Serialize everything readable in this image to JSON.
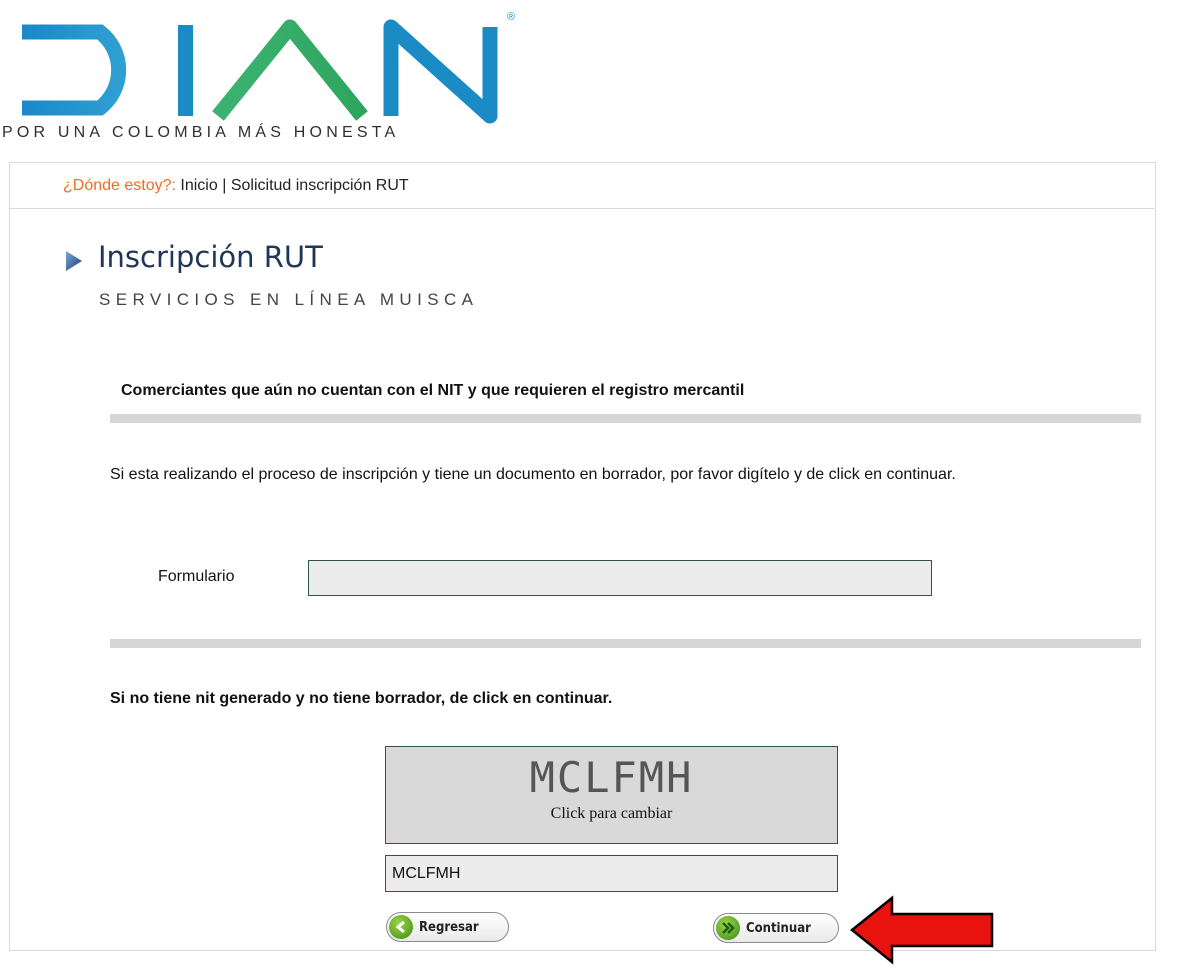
{
  "logo": {
    "wordmark": "DIAN",
    "registered": "®",
    "tagline": "POR UNA COLOMBIA MÁS HONESTA"
  },
  "breadcrumb": {
    "prefix": "¿Dónde estoy?:",
    "home": "Inicio",
    "separator": "|",
    "current": "Solicitud inscripción RUT"
  },
  "page": {
    "title": "Inscripción RUT",
    "subtitle": "SERVICIOS EN LÍNEA MUISCA"
  },
  "section1": {
    "heading": "Comerciantes que aún no cuentan con el NIT y que requieren el registro mercantil",
    "instructions": "Si esta realizando el proceso de inscripción y tiene un documento en borrador, por favor digítelo y de click en continuar.",
    "form_label": "Formulario",
    "form_value": ""
  },
  "section2": {
    "heading": "Si no tiene nit generado y no tiene borrador, de click en continuar."
  },
  "captcha": {
    "code": "MCLFMH",
    "hint": "Click para cambiar",
    "input_value": "MCLFMH"
  },
  "buttons": {
    "back": "Regresar",
    "next": "Continuar"
  },
  "colors": {
    "logo_blue": "#1b8bc6",
    "logo_green": "#34b56a",
    "breadcrumb_orange": "#f26b1d",
    "border_green": "#2e5742",
    "annotation_red": "#e8130f"
  },
  "icons": [
    "title-arrow-icon",
    "back-chevron-icon",
    "forward-double-chevron-icon",
    "red-pointer-arrow-icon"
  ]
}
